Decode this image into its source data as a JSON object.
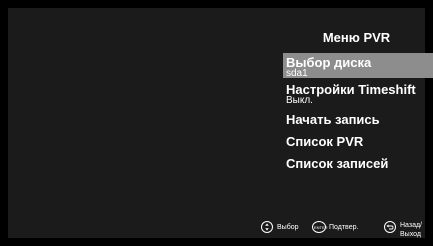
{
  "menu": {
    "title": "Меню PVR",
    "items": [
      {
        "label": "Выбор диска",
        "value": "sda1"
      },
      {
        "label": "Настройки Timeshift",
        "value": "Выкл."
      },
      {
        "label": "Начать запись"
      },
      {
        "label": "Список PVR"
      },
      {
        "label": "Список записей"
      }
    ]
  },
  "hints": {
    "select": "Выбор",
    "confirm": "Подтвер.",
    "enter_badge": "ENTER",
    "back_exit_line1": "Назад/",
    "back_exit_line2": "Выход"
  },
  "icons": {
    "select": "dpad-updown-icon",
    "confirm": "enter-button-icon",
    "back": "return-arrow-icon"
  },
  "colors": {
    "background": "#000000",
    "panel": "#1b1b1b",
    "highlight": "#8d8d8d",
    "text": "#ffffff"
  }
}
